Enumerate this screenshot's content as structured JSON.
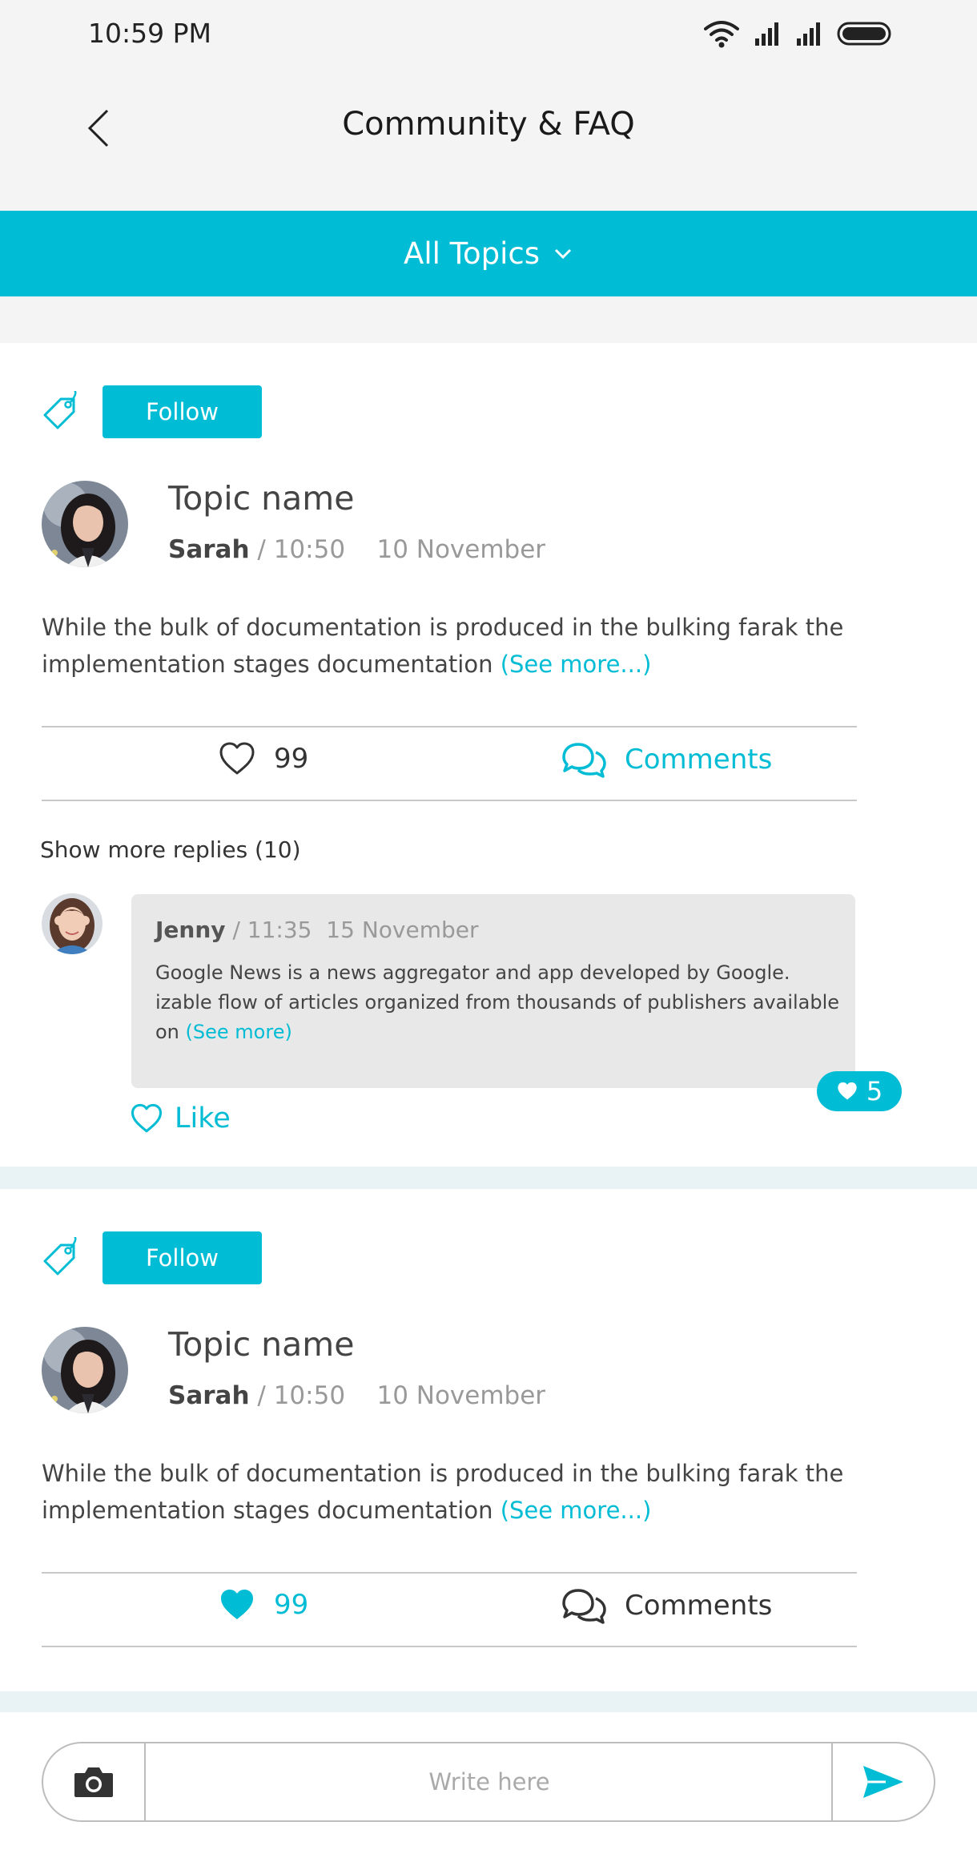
{
  "status_bar": {
    "time": "10:59 PM"
  },
  "header": {
    "title": "Community & FAQ"
  },
  "topics_filter": {
    "label": "All Topics"
  },
  "posts": [
    {
      "follow_label": "Follow",
      "topic_name": "Topic name",
      "author": "Sarah",
      "separator": "/",
      "time": "10:50",
      "date": "10 November",
      "body": "While the bulk of documentation is produced in the bulking farak the implementation stages documentation",
      "see_more": "(See more...)",
      "likes": "99",
      "liked": false,
      "comments_label": "Comments",
      "comments_active": true,
      "show_more_replies": "Show more replies (10)",
      "reply": {
        "author": "Jenny",
        "separator": "/",
        "time": "11:35",
        "date": "15 November",
        "text": "Google News is a news aggregator and app developed by Google. izable flow of articles organized from thousands of publishers available on",
        "see_more": "(See more)",
        "like_count": "5",
        "like_label": "Like"
      }
    },
    {
      "follow_label": "Follow",
      "topic_name": "Topic name",
      "author": "Sarah",
      "separator": "/",
      "time": "10:50",
      "date": "10 November",
      "body": "While the bulk of documentation is produced in the bulking farak the implementation stages documentation",
      "see_more": "(See more...)",
      "likes": "99",
      "liked": true,
      "comments_label": "Comments",
      "comments_active": false
    }
  ],
  "composer": {
    "placeholder": "Write here"
  },
  "colors": {
    "accent": "#00bcd4",
    "text": "#444444",
    "muted": "#999999",
    "bubble": "#e8e8e8"
  }
}
